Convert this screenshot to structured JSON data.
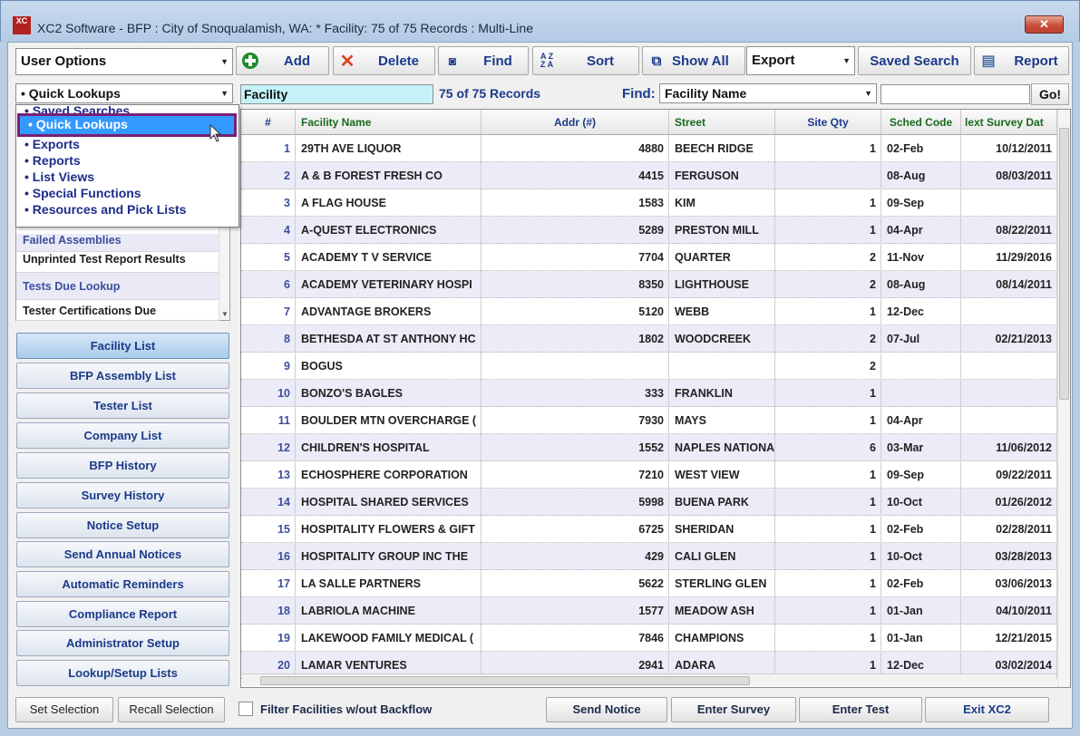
{
  "window": {
    "title": "XC2 Software - BFP : City of Snoqualamish, WA: * Facility: 75 of 75 Records : Multi-Line",
    "logo": "XC",
    "close": "✕"
  },
  "toolbar": {
    "user_options": "User Options",
    "add": "Add",
    "delete": "Delete",
    "find": "Find",
    "sort": "Sort",
    "show_all": "Show All",
    "export": "Export",
    "saved_search": "Saved Search",
    "report": "Report"
  },
  "lookup_combo": "Quick Lookups",
  "facility_label": "Facility",
  "record_count": "75 of 75 Records",
  "find_label": "Find:",
  "find_field": "Facility Name",
  "find_value": "",
  "go": "Go!",
  "dropdown_items": [
    "Saved Searches",
    "Quick Lookups",
    "Exports",
    "Reports",
    "List Views",
    "Special Functions",
    "Resources and Pick Lists"
  ],
  "quick_list": [
    "Failed Assemblies",
    "Unprinted Test Report Results",
    "Tests Due Lookup",
    "Tester Certifications Due"
  ],
  "nav": [
    "Facility List",
    "BFP Assembly List",
    "Tester List",
    "Company List",
    "BFP History",
    "Survey History",
    "Notice Setup",
    "Send Annual Notices",
    "Automatic Reminders",
    "Compliance Report",
    "Administrator Setup",
    "Lookup/Setup Lists"
  ],
  "grid": {
    "headers": [
      "#",
      "Facility Name",
      "Addr (#)",
      "Street",
      "Site Qty",
      "Sched Code",
      "lext Survey Dat"
    ],
    "rows": [
      [
        "1",
        "29TH AVE LIQUOR",
        "4880",
        "BEECH RIDGE",
        "1",
        "02-Feb",
        "10/12/2011"
      ],
      [
        "2",
        "A & B FOREST FRESH CO",
        "4415",
        "FERGUSON",
        "",
        "08-Aug",
        "08/03/2011"
      ],
      [
        "3",
        "A FLAG HOUSE",
        "1583",
        "KIM",
        "1",
        "09-Sep",
        ""
      ],
      [
        "4",
        "A-QUEST ELECTRONICS",
        "5289",
        "PRESTON MILL",
        "1",
        "04-Apr",
        "08/22/2011"
      ],
      [
        "5",
        "ACADEMY T V SERVICE",
        "7704",
        "QUARTER",
        "2",
        "11-Nov",
        "11/29/2016"
      ],
      [
        "6",
        "ACADEMY VETERINARY HOSPI",
        "8350",
        "LIGHTHOUSE",
        "2",
        "08-Aug",
        "08/14/2011"
      ],
      [
        "7",
        "ADVANTAGE BROKERS",
        "5120",
        "WEBB",
        "1",
        "12-Dec",
        ""
      ],
      [
        "8",
        "BETHESDA AT ST ANTHONY HC",
        "1802",
        "WOODCREEK",
        "2",
        "07-Jul",
        "02/21/2013"
      ],
      [
        "9",
        "BOGUS",
        "",
        "",
        "2",
        "",
        ""
      ],
      [
        "10",
        "BONZO'S BAGLES",
        "333",
        "FRANKLIN",
        "1",
        "",
        ""
      ],
      [
        "11",
        "BOULDER MTN OVERCHARGE (",
        "7930",
        "MAYS",
        "1",
        "04-Apr",
        ""
      ],
      [
        "12",
        "CHILDREN'S HOSPITAL",
        "1552",
        "NAPLES NATIONA",
        "6",
        "03-Mar",
        "11/06/2012"
      ],
      [
        "13",
        "ECHOSPHERE CORPORATION",
        "7210",
        "WEST VIEW",
        "1",
        "09-Sep",
        "09/22/2011"
      ],
      [
        "14",
        "HOSPITAL SHARED SERVICES",
        "5998",
        "BUENA PARK",
        "1",
        "10-Oct",
        "01/26/2012"
      ],
      [
        "15",
        "HOSPITALITY FLOWERS & GIFT",
        "6725",
        "SHERIDAN",
        "1",
        "02-Feb",
        "02/28/2011"
      ],
      [
        "16",
        "HOSPITALITY GROUP INC THE",
        "429",
        "CALI GLEN",
        "1",
        "10-Oct",
        "03/28/2013"
      ],
      [
        "17",
        "LA SALLE PARTNERS",
        "5622",
        "STERLING GLEN",
        "1",
        "02-Feb",
        "03/06/2013"
      ],
      [
        "18",
        "LABRIOLA MACHINE",
        "1577",
        "MEADOW ASH",
        "1",
        "01-Jan",
        "04/10/2011"
      ],
      [
        "19",
        "LAKEWOOD FAMILY MEDICAL (",
        "7846",
        "CHAMPIONS",
        "1",
        "01-Jan",
        "12/21/2015"
      ],
      [
        "20",
        "LAMAR VENTURES",
        "2941",
        "ADARA",
        "1",
        "12-Dec",
        "03/02/2014"
      ]
    ]
  },
  "bottom": {
    "set_selection": "Set Selection",
    "recall_selection": "Recall Selection",
    "filter_label": "Filter Facilities w/out Backflow",
    "send_notice": "Send Notice",
    "enter_survey": "Enter Survey",
    "enter_test": "Enter Test",
    "exit": "Exit XC2"
  }
}
